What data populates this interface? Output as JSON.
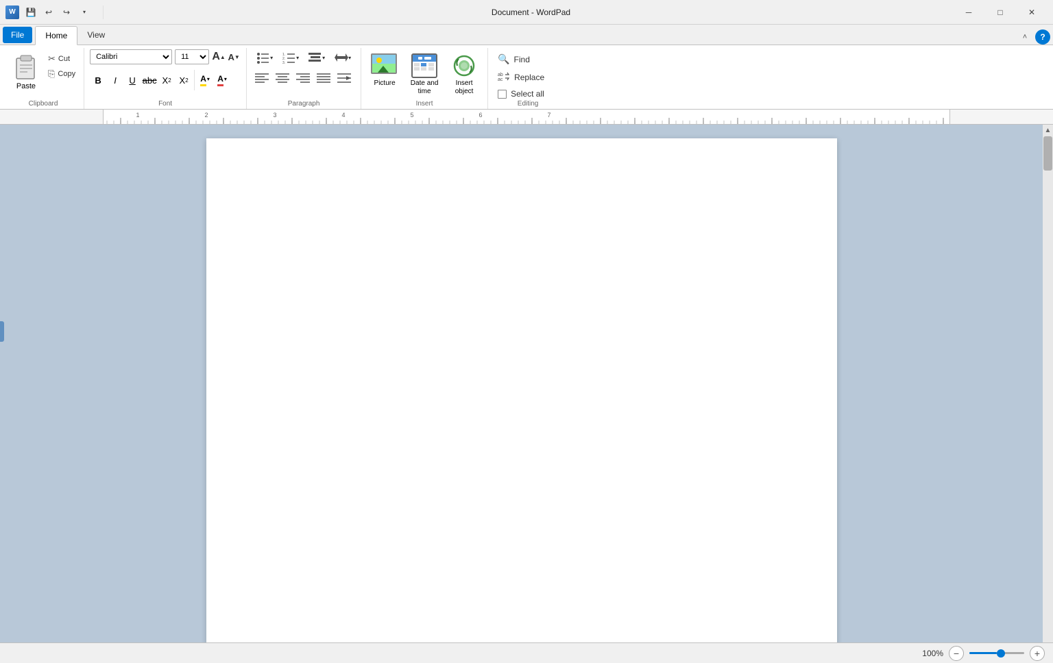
{
  "titlebar": {
    "app_icon": "W",
    "title": "Document - WordPad",
    "save_btn": "💾",
    "undo_btn": "↩",
    "redo_btn": "↪",
    "dropdown_btn": "▾",
    "minimize": "─",
    "maximize": "□",
    "close": "✕"
  },
  "tabs": {
    "file": "File",
    "home": "Home",
    "view": "View"
  },
  "ribbon": {
    "clipboard": {
      "label": "Clipboard",
      "paste": "Paste",
      "cut": "Cut",
      "copy": "Copy"
    },
    "font": {
      "label": "Font",
      "font_name": "Calibri",
      "font_size": "11",
      "grow": "A",
      "shrink": "A",
      "bold": "B",
      "italic": "I",
      "underline": "U",
      "strikethrough": "abc",
      "subscript": "X",
      "superscript": "X",
      "text_color": "A",
      "highlight": "A"
    },
    "paragraph": {
      "label": "Paragraph",
      "bullets": "☰",
      "numbering": "☰",
      "list_style": "☰",
      "line_spacing": "↕",
      "align_left": "≡",
      "align_center": "≡",
      "align_right": "≡",
      "align_justify": "≡",
      "indent_right": "⇥"
    },
    "insert": {
      "label": "Insert",
      "picture_label": "Picture",
      "datetime_label": "Date and time",
      "object_label": "Insert object"
    },
    "editing": {
      "label": "Editing",
      "find": "Find",
      "replace": "Replace",
      "select_all": "Select all"
    }
  },
  "statusbar": {
    "zoom_level": "100%"
  }
}
